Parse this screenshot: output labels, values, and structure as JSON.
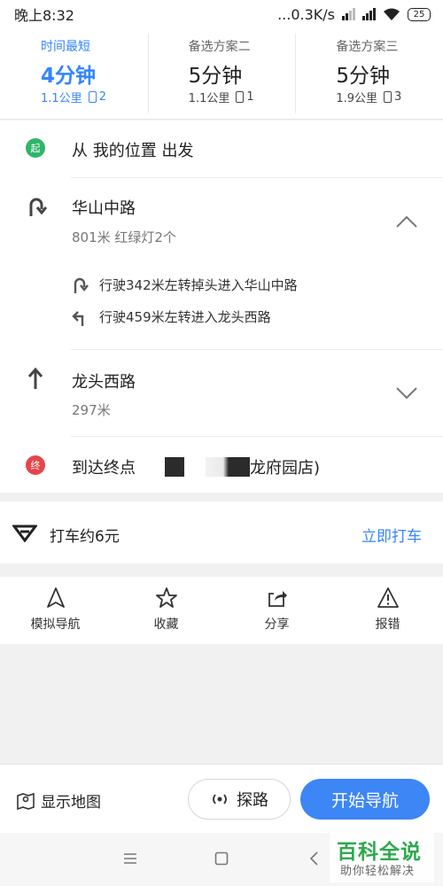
{
  "status": {
    "time": "晚上8:32",
    "speed": "...0.3K/s",
    "battery": "25"
  },
  "routes": [
    {
      "label": "时间最短",
      "time": "4分钟",
      "distance": "1.1公里",
      "lights": "2",
      "active": true
    },
    {
      "label": "备选方案二",
      "time": "5分钟",
      "distance": "1.1公里",
      "lights": "1",
      "active": false
    },
    {
      "label": "备选方案三",
      "time": "5分钟",
      "distance": "1.9公里",
      "lights": "3",
      "active": false
    }
  ],
  "steps": {
    "start_badge": "起",
    "start_text": "从  我的位置  出发",
    "road1_name": "华山中路",
    "road1_detail": "801米  红绿灯2个",
    "road1_sub1": "行驶342米左转掉头进入华山中路",
    "road1_sub2": "行驶459米左转进入龙头西路",
    "road2_name": "龙头西路",
    "road2_detail": "297米",
    "end_badge": "终",
    "end_text": "到达终点",
    "end_place_tail": "龙府园店)"
  },
  "taxi": {
    "label": "打车约6元",
    "action": "立即打车"
  },
  "actions": [
    {
      "label": "模拟导航",
      "icon": "navigate-arrow-icon"
    },
    {
      "label": "收藏",
      "icon": "star-icon"
    },
    {
      "label": "分享",
      "icon": "share-icon"
    },
    {
      "label": "报错",
      "icon": "warning-icon"
    }
  ],
  "bottom": {
    "map_label": "显示地图",
    "probe_label": "探路",
    "start_label": "开始导航"
  },
  "watermark": {
    "title": "百科全说",
    "subtitle": "助你轻松解决"
  },
  "colors": {
    "accent": "#3385ff",
    "start": "#2fb56a",
    "end": "#e5454b",
    "brand_green": "#2fa84f"
  }
}
